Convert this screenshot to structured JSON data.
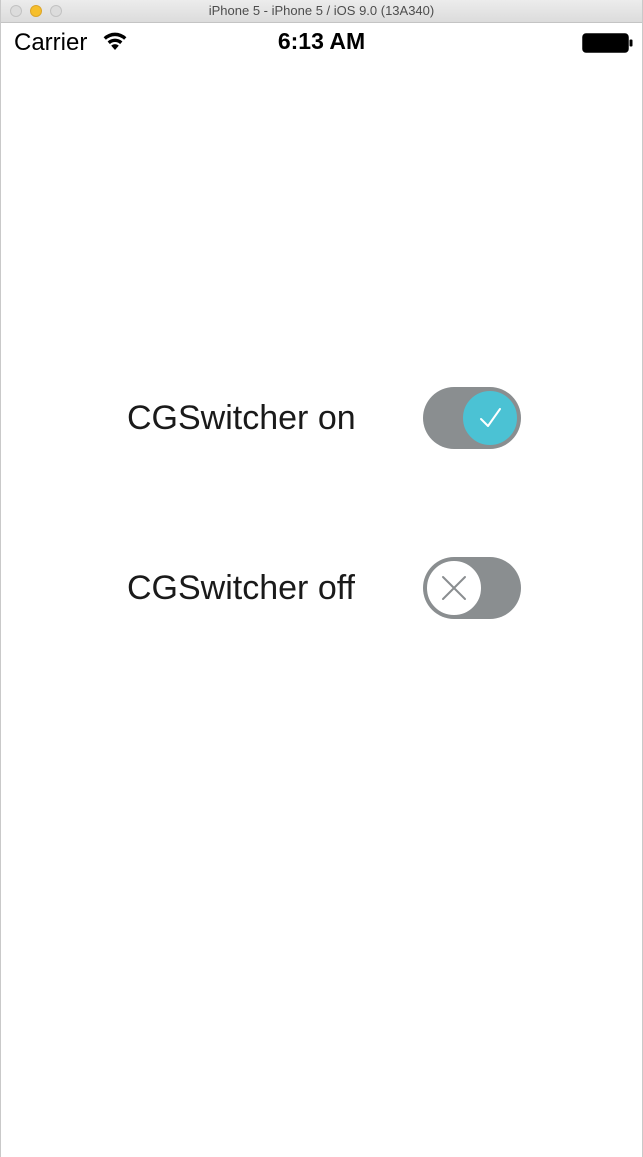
{
  "window": {
    "title": "iPhone 5 - iPhone 5 / iOS 9.0 (13A340)"
  },
  "status_bar": {
    "carrier": "Carrier",
    "time": "6:13 AM",
    "icons": [
      "wifi-icon",
      "battery-icon"
    ]
  },
  "switches": [
    {
      "label": "CGSwitcher on",
      "state": "on",
      "knob_icon": "checkmark-icon"
    },
    {
      "label": "CGSwitcher off",
      "state": "off",
      "knob_icon": "x-icon"
    }
  ],
  "colors": {
    "track": "#8a8e90",
    "on_knob": "#4bc2d4",
    "off_knob": "#ffffff",
    "background": "#ffffff"
  }
}
